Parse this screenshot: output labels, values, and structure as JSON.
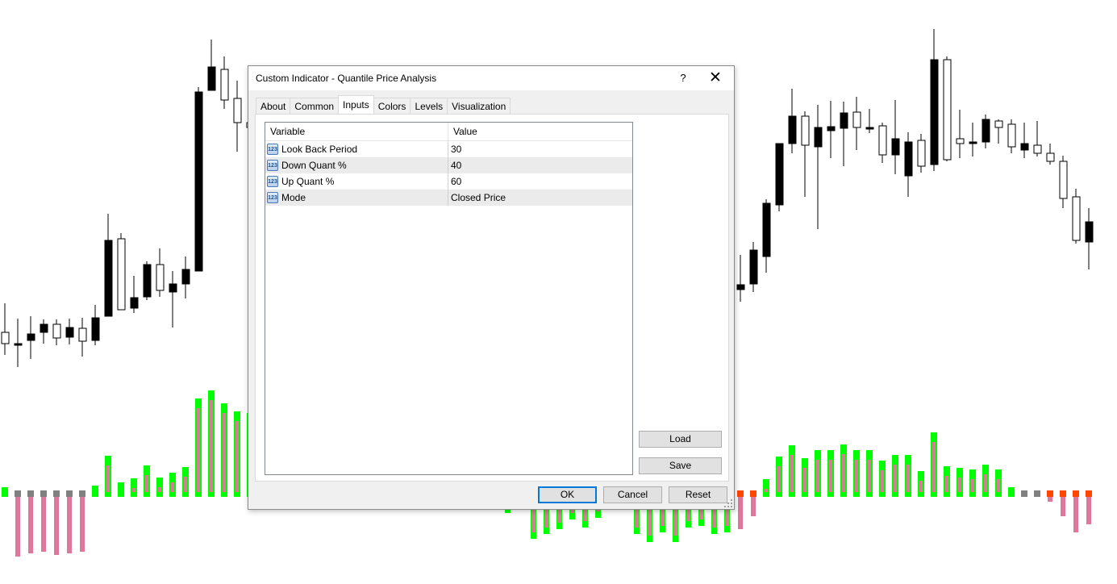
{
  "dialog": {
    "title": "Custom Indicator - Quantile Price Analysis",
    "help_label": "?",
    "close_label": "✕",
    "tabs": [
      {
        "label": "About",
        "active": false
      },
      {
        "label": "Common",
        "active": false
      },
      {
        "label": "Inputs",
        "active": true
      },
      {
        "label": "Colors",
        "active": false
      },
      {
        "label": "Levels",
        "active": false
      },
      {
        "label": "Visualization",
        "active": false
      }
    ],
    "grid": {
      "columns": [
        "Variable",
        "Value"
      ],
      "rows": [
        {
          "variable": "Look Back Period",
          "value": "30",
          "icon": "number-icon"
        },
        {
          "variable": "Down Quant %",
          "value": "40",
          "icon": "number-icon"
        },
        {
          "variable": "Up Quant %",
          "value": "60",
          "icon": "number-icon"
        },
        {
          "variable": "Mode",
          "value": "Closed Price",
          "icon": "number-icon"
        }
      ]
    },
    "buttons": {
      "load": "Load",
      "save": "Save",
      "ok": "OK",
      "cancel": "Cancel",
      "reset": "Reset"
    },
    "number_icon_glyph": "123"
  },
  "colors": {
    "candle_body": "#000000",
    "histogram_green": "#00ff00",
    "histogram_pink": "#e0779b",
    "histogram_gray": "#808080",
    "histogram_orange": "#ff4500",
    "accent": "#0078d7"
  }
}
